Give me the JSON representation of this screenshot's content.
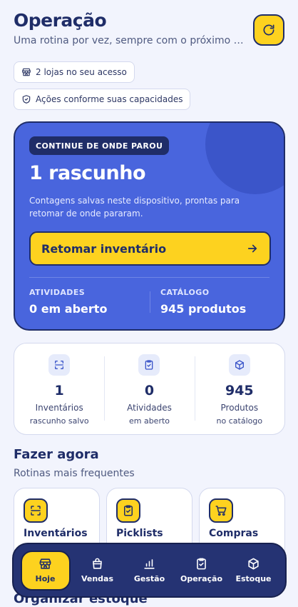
{
  "header": {
    "title": "Operação",
    "subtitle": "Uma rotina por vez, sempre com o próximo p...",
    "refresh_icon": "refresh-icon"
  },
  "chips": [
    {
      "label": "2 lojas no seu acesso",
      "icon": "store-icon"
    },
    {
      "label": "Ações conforme suas capacidades",
      "icon": "shield-check-icon"
    }
  ],
  "hero": {
    "badge": "CONTINUE DE ONDE PAROU",
    "title": "1 rascunho",
    "description": "Contagens salvas neste dispositivo, prontas para retomar de onde pararam.",
    "button_label": "Retomar inventário",
    "stats": [
      {
        "label": "ATIVIDADES",
        "value": "0 em aberto"
      },
      {
        "label": "CATÁLOGO",
        "value": "945 produtos"
      }
    ]
  },
  "stats": [
    {
      "number": "1",
      "name": "Inventários",
      "sub": "rascunho salvo",
      "icon": "scan-icon"
    },
    {
      "number": "0",
      "name": "Atividades",
      "sub": "em aberto",
      "icon": "clipboard-check-icon"
    },
    {
      "number": "945",
      "name": "Produtos",
      "sub": "no catálogo",
      "icon": "box-icon"
    }
  ],
  "section": {
    "title": "Fazer agora",
    "subtitle": "Rotinas mais frequentes",
    "next_title": "Organizar estoque"
  },
  "quick_actions": [
    {
      "label": "Inventários",
      "icon": "scan-icon"
    },
    {
      "label": "Picklists",
      "icon": "clipboard-check-icon"
    },
    {
      "label": "Compras",
      "icon": "cart-icon"
    }
  ],
  "nav": [
    {
      "label": "Hoje",
      "icon": "store-icon",
      "active": true
    },
    {
      "label": "Vendas",
      "icon": "bag-icon",
      "active": false
    },
    {
      "label": "Gestão",
      "icon": "bar-chart-icon",
      "active": false
    },
    {
      "label": "Operação",
      "icon": "clipboard-check-icon",
      "active": false
    },
    {
      "label": "Estoque",
      "icon": "box-icon",
      "active": false
    }
  ],
  "colors": {
    "accent_yellow": "#fdd21f",
    "hero_blue": "#4965dd",
    "navy": "#1f2d68",
    "background": "#f2f4fd"
  }
}
